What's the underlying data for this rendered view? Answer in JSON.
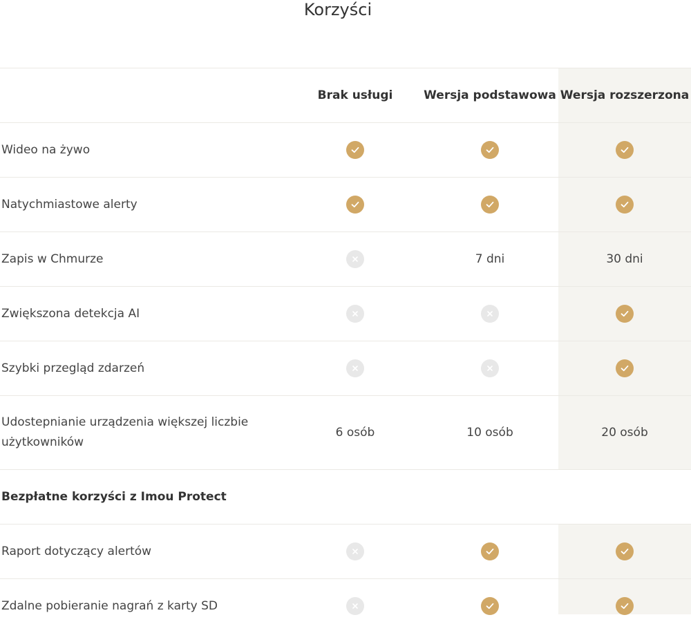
{
  "title": "Korzyści",
  "columns": [
    "Brak usługi",
    "Wersja podstawowa",
    "Wersja rozszerzona"
  ],
  "rows": [
    {
      "label": "Wideo na żywo",
      "cells": [
        {
          "type": "check"
        },
        {
          "type": "check"
        },
        {
          "type": "check"
        }
      ]
    },
    {
      "label": "Natychmiastowe alerty",
      "cells": [
        {
          "type": "check"
        },
        {
          "type": "check"
        },
        {
          "type": "check"
        }
      ]
    },
    {
      "label": "Zapis w Chmurze",
      "cells": [
        {
          "type": "cross"
        },
        {
          "type": "text",
          "text": "7 dni"
        },
        {
          "type": "text",
          "text": "30 dni"
        }
      ]
    },
    {
      "label": "Zwiększona detekcja AI",
      "cells": [
        {
          "type": "cross"
        },
        {
          "type": "cross"
        },
        {
          "type": "check"
        }
      ]
    },
    {
      "label": "Szybki przegląd zdarzeń",
      "cells": [
        {
          "type": "cross"
        },
        {
          "type": "cross"
        },
        {
          "type": "check"
        }
      ]
    },
    {
      "label": "Udostepnianie urządzenia większej liczbie użytkowników",
      "cells": [
        {
          "type": "text",
          "text": "6 osób"
        },
        {
          "type": "text",
          "text": "10 osób"
        },
        {
          "type": "text",
          "text": "20 osób"
        }
      ]
    }
  ],
  "section_title": "Bezpłatne korzyści z Imou Protect",
  "free_rows": [
    {
      "label": "Raport dotyczący alertów",
      "cells": [
        {
          "type": "cross"
        },
        {
          "type": "check"
        },
        {
          "type": "check"
        }
      ]
    },
    {
      "label": "Zdalne pobieranie nagrań z karty SD",
      "cells": [
        {
          "type": "cross"
        },
        {
          "type": "check"
        },
        {
          "type": "check"
        }
      ]
    }
  ],
  "icons": {
    "check": "check-icon",
    "cross": "cross-icon"
  },
  "colors": {
    "check": "#d1a866",
    "cross": "#e8e8e8",
    "highlight": "#f5f4f0"
  }
}
